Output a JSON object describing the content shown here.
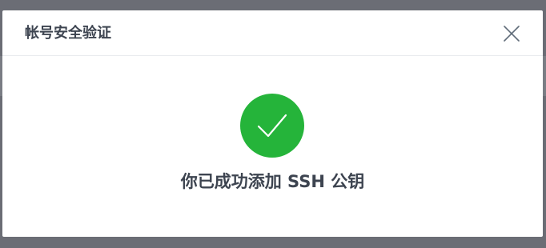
{
  "dialog": {
    "title": "帐号安全验证",
    "close_icon": "close-icon",
    "success_icon": "checkmark-circle-icon",
    "message": "你已成功添加 SSH 公钥"
  },
  "colors": {
    "success_green": "#25b43a",
    "text_dark": "#3d4450",
    "overlay": "#6b6d75"
  }
}
